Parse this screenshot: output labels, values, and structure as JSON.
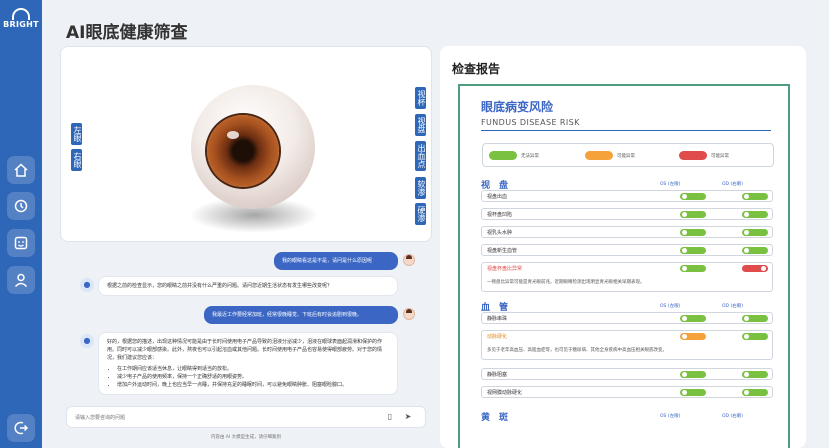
{
  "sidebar": {
    "logo": "BRIGHT",
    "nav": [
      "home-icon",
      "history-icon",
      "face-scan-icon",
      "user-icon",
      "logout-icon"
    ],
    "accent": "#2e66b8"
  },
  "page": {
    "title": "AI眼底健康筛查"
  },
  "viewer": {
    "left_tags": [
      "左眼",
      "右眼"
    ],
    "right_tags": [
      "视杯",
      "视盘",
      "出血点",
      "软渗",
      "硬渗"
    ]
  },
  "chat": {
    "messages": [
      {
        "role": "user",
        "text": "我的眼睛看这是不是，请问是什么原因呢"
      },
      {
        "role": "assistant",
        "text": "根据之前的检查显示，您的眼睛之前并没有什么严重的问题。请问您近期生活状态有发生哪些改变呢？"
      },
      {
        "role": "user",
        "text": "我最近工作要经常加班，经常很晚睡觉、下班后有时会追剧到很晚。"
      },
      {
        "role": "assistant",
        "text": "好的，根据您的描述，出现这种情况可能是由于长时间使用电子产品导致的泪液分泌减少，泪液在眼球表面起润滑和保护的作用。同时可以减少眼部感染。此外，熬夜也可以引起溶血或其他问题。长时间使用电子产品也容易使得眼部疲劳。对于您的情况，我们建议您应该：",
        "bullets": [
          "在工作期间应该适当休息，让眼睛得到适当的放松。",
          "减少电子产品的使用频率，保持一个正确舒适的用眼姿势。",
          "增加户外运动时间，晚上也应当早一点睡，并保持充足的睡眠时间，可以避免眼睛肿胀、阻塞眼睑腺口。"
        ]
      }
    ],
    "input_placeholder": "请输入您要咨询的问题",
    "disclaimer": "内容由 AI 大模型生成，请仔细甄别"
  },
  "report": {
    "panel_title": "检查报告",
    "title": "眼底病变风险",
    "subtitle": "FUNDUS DISEASE RISK",
    "legend": [
      "无法异常",
      "可能异常",
      "可能异常"
    ],
    "legend_colors": [
      "#7ac142",
      "#f5a23a",
      "#e04b4b"
    ],
    "col_os": "OS (左眼)",
    "col_od": "OD (右眼)",
    "sections": [
      {
        "name": "视　盘",
        "rows": [
          {
            "label": "视盘出血",
            "os": "normal",
            "od": "normal"
          },
          {
            "label": "视杯盘凹陷",
            "os": "normal",
            "od": "normal"
          },
          {
            "label": "视乳头水肿",
            "os": "normal",
            "od": "normal"
          },
          {
            "label": "视盘新生血管",
            "os": "normal",
            "od": "normal"
          },
          {
            "label": "视盘杯盘比异常",
            "os": "normal",
            "od": "abnormal",
            "highlight": true,
            "note": "一侧盘比异常可能是青光眼前兆，近期眼睛检测出现明显青光眼相关早期表现。"
          }
        ]
      },
      {
        "name": "血　管",
        "rows": [
          {
            "label": "静脉串珠",
            "os": "normal",
            "od": "normal"
          },
          {
            "label": "动脉硬化",
            "os": "possible",
            "od": "normal",
            "highlight": true,
            "note": "多见于老年高血压、高脂血症等，也可见于糖尿病、其他全身疾病中高血压相关眼底改变。"
          },
          {
            "label": "静脉阻塞",
            "os": "normal",
            "od": "normal"
          },
          {
            "label": "视网膜动脉硬化",
            "os": "normal",
            "od": "normal"
          }
        ]
      },
      {
        "name": "黄　斑",
        "rows": []
      }
    ]
  }
}
